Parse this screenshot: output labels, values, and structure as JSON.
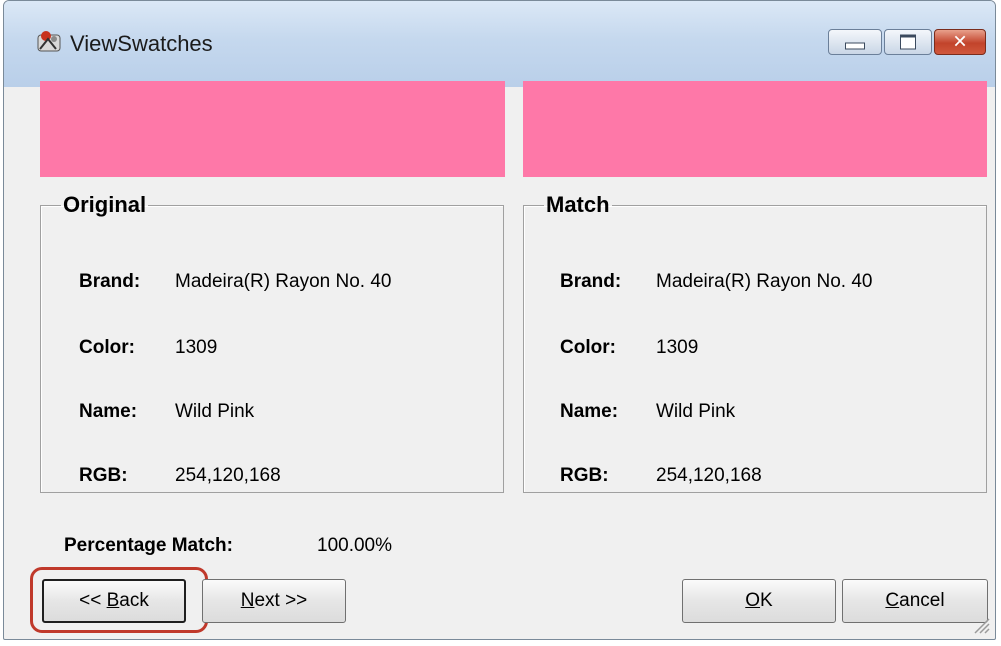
{
  "window": {
    "title": "ViewSwatches",
    "controls": {
      "minimize_icon": "minimize-icon",
      "maximize_icon": "maximize-icon",
      "close_glyph": "✕"
    }
  },
  "swatches": {
    "original_color": "#FE78A8",
    "match_color": "#FE78A8"
  },
  "original": {
    "heading": "Original",
    "brand_label": "Brand:",
    "brand": "Madeira(R) Rayon No. 40",
    "color_label": "Color:",
    "color": "1309",
    "name_label": "Name:",
    "name": "Wild Pink",
    "rgb_label": "RGB:",
    "rgb": "254,120,168"
  },
  "match": {
    "heading": "Match",
    "brand_label": "Brand:",
    "brand": "Madeira(R) Rayon No. 40",
    "color_label": "Color:",
    "color": "1309",
    "name_label": "Name:",
    "name": "Wild Pink",
    "rgb_label": "RGB:",
    "rgb": "254,120,168"
  },
  "percentage": {
    "label": "Percentage Match:",
    "value": "100.00%"
  },
  "buttons": {
    "back_prefix": "<< ",
    "back_mnemonic": "B",
    "back_rest": "ack",
    "next_mnemonic": "N",
    "next_rest": "ext >>",
    "ok_mnemonic": "O",
    "ok_rest": "K",
    "cancel_mnemonic": "C",
    "cancel_rest": "ancel"
  },
  "annotation": {
    "highlight_color": "#C0392B",
    "target": "back-button"
  }
}
